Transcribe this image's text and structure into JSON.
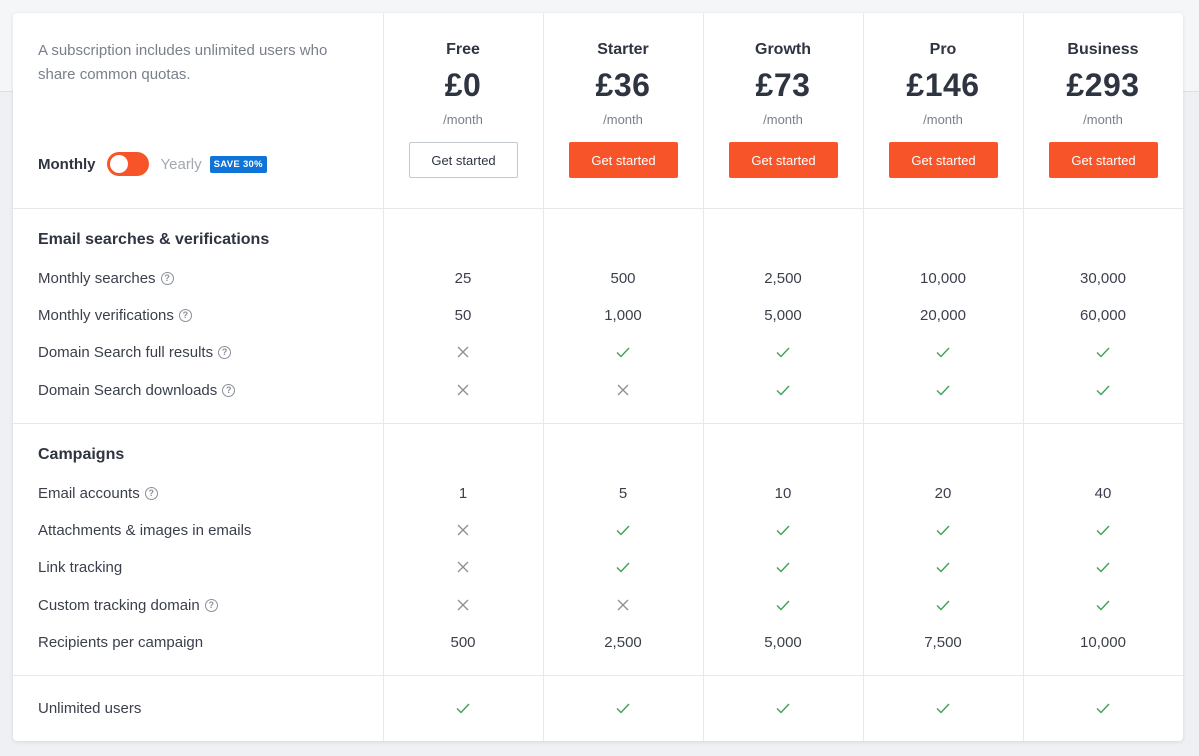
{
  "intro": "A subscription includes unlimited users who share common quotas.",
  "billing": {
    "monthly": "Monthly",
    "yearly": "Yearly",
    "badge": "SAVE 30%",
    "toggle_on": true
  },
  "colors": {
    "accent": "#f8542a",
    "badge": "#0f73d8",
    "check": "#3aa352",
    "cross": "#8a8f99"
  },
  "plans": [
    {
      "name": "Free",
      "price": "£0",
      "period": "/month",
      "cta": "Get started",
      "style": "outline"
    },
    {
      "name": "Starter",
      "price": "£36",
      "period": "/month",
      "cta": "Get started",
      "style": "primary"
    },
    {
      "name": "Growth",
      "price": "£73",
      "period": "/month",
      "cta": "Get started",
      "style": "primary"
    },
    {
      "name": "Pro",
      "price": "£146",
      "period": "/month",
      "cta": "Get started",
      "style": "primary"
    },
    {
      "name": "Business",
      "price": "£293",
      "period": "/month",
      "cta": "Get started",
      "style": "primary"
    }
  ],
  "sections": [
    {
      "title": "Email searches & verifications",
      "rows": [
        {
          "label": "Monthly searches",
          "help": true,
          "values": [
            "25",
            "500",
            "2,500",
            "10,000",
            "30,000"
          ]
        },
        {
          "label": "Monthly verifications",
          "help": true,
          "values": [
            "50",
            "1,000",
            "5,000",
            "20,000",
            "60,000"
          ]
        },
        {
          "label": "Domain Search full results",
          "help": true,
          "values": [
            false,
            true,
            true,
            true,
            true
          ]
        },
        {
          "label": "Domain Search downloads",
          "help": true,
          "values": [
            false,
            false,
            true,
            true,
            true
          ]
        }
      ]
    },
    {
      "title": "Campaigns",
      "rows": [
        {
          "label": "Email accounts",
          "help": true,
          "values": [
            "1",
            "5",
            "10",
            "20",
            "40"
          ]
        },
        {
          "label": "Attachments & images in emails",
          "help": false,
          "values": [
            false,
            true,
            true,
            true,
            true
          ]
        },
        {
          "label": "Link tracking",
          "help": false,
          "values": [
            false,
            true,
            true,
            true,
            true
          ]
        },
        {
          "label": "Custom tracking domain",
          "help": true,
          "values": [
            false,
            false,
            true,
            true,
            true
          ]
        },
        {
          "label": "Recipients per campaign",
          "help": false,
          "values": [
            "500",
            "2,500",
            "5,000",
            "7,500",
            "10,000"
          ]
        }
      ]
    },
    {
      "title": "",
      "rows": [
        {
          "label": "Unlimited users",
          "help": false,
          "values": [
            true,
            true,
            true,
            true,
            true
          ]
        }
      ]
    }
  ]
}
